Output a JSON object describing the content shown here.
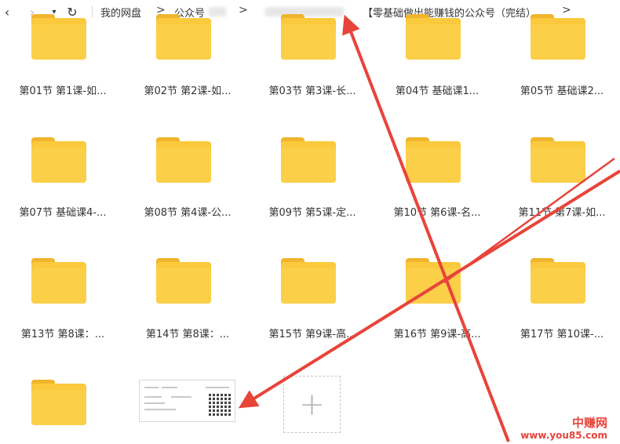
{
  "toolbar": {
    "back_icon": "‹",
    "forward_icon": "›",
    "dropdown_icon": "▾",
    "refresh_icon": "↻",
    "sep": ">"
  },
  "breadcrumb": {
    "root": "我的网盘",
    "second": "公众号",
    "current": "【零基础做出能赚钱的公众号（完结）"
  },
  "folders": [
    "第01节 第1课-如...",
    "第02节 第2课-如...",
    "第03节 第3课-长...",
    "第04节 基础课1...",
    "第05节 基础课2...",
    "第07节 基础课4-...",
    "第08节 第4课-公...",
    "第09节 第5课-定...",
    "第10节 第6课-名...",
    "第11节 第7课-如...",
    "第13节 第8课：...",
    "第14节 第8课：...",
    "第15节 第9课-高...",
    "第16节 第9课-高...",
    "第17节 第10课-..."
  ],
  "add_tile": {
    "icon": "+"
  },
  "watermark": {
    "name": "中赚网",
    "url": "www.you85.com"
  },
  "colors": {
    "folder": "#fbc93d",
    "arrow": "#e8443a"
  }
}
